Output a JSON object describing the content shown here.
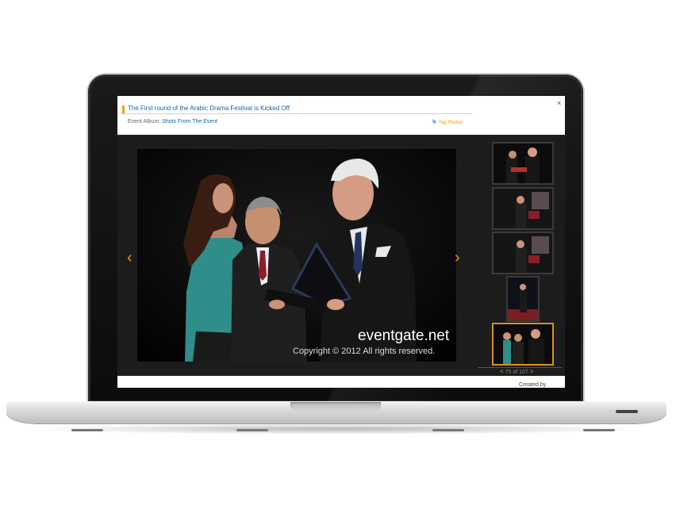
{
  "gallery": {
    "title": "The First round of the Arabic Drama Festival is Kicked Off",
    "album_label": "Event Album:",
    "album_name": "Shots From The Event",
    "tag_photos": "Tag Photos",
    "close": "×"
  },
  "viewer": {
    "prev": "‹",
    "next": "›",
    "watermark_site": "eventgate.net",
    "watermark_copyright": "Copyright © 2012 All rights reserved."
  },
  "pager": {
    "prev": "<",
    "text": "75 of 107",
    "next": ">"
  },
  "footer": {
    "created_by": "Created by"
  },
  "colors": {
    "accent": "#e29a1f",
    "link": "#1565a8",
    "viewer_bg": "#1c1c1c"
  }
}
